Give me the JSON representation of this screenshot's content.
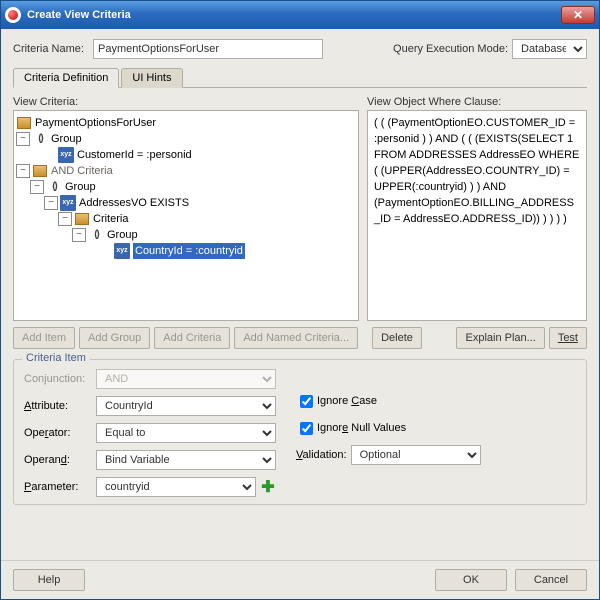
{
  "window": {
    "title": "Create View Criteria"
  },
  "header": {
    "criteria_name_label": "Criteria Name:",
    "criteria_name_value": "PaymentOptionsForUser",
    "qem_label": "Query Execution Mode:",
    "qem_value": "Database"
  },
  "tabs": {
    "definition": "Criteria Definition",
    "uihints": "UI Hints"
  },
  "labels": {
    "view_criteria": "View Criteria:",
    "where_clause": "View Object Where Clause:"
  },
  "tree": {
    "root": "PaymentOptionsForUser",
    "group1": "Group",
    "cust": "CustomerId = :personid",
    "and_criteria": "AND Criteria",
    "group2": "Group",
    "addrvo": "AddressesVO EXISTS",
    "criteria": "Criteria",
    "group3": "Group",
    "selected": "CountryId = :countryid"
  },
  "where_clause": "( ( (PaymentOptionEO.CUSTOMER_ID = :personid ) )  AND ( ( (EXISTS(SELECT 1 FROM ADDRESSES AddressEO WHERE ( (UPPER(AddressEO.COUNTRY_ID) = UPPER(:countryid) ) )  AND (PaymentOptionEO.BILLING_ADDRESS_ID = AddressEO.ADDRESS_ID)) ) ) ) )",
  "buttons": {
    "add_item": "Add Item",
    "add_group": "Add Group",
    "add_criteria": "Add Criteria",
    "add_named": "Add Named Criteria...",
    "delete": "Delete",
    "explain": "Explain Plan...",
    "test": "Test"
  },
  "criteria_item": {
    "legend": "Criteria Item",
    "conjunction_label": "Conjunction:",
    "conjunction_value": "AND",
    "attribute_label": "Attribute:",
    "attribute_value": "CountryId",
    "operator_label": "Operator:",
    "operator_value": "Equal to",
    "operand_label": "Operand:",
    "operand_value": "Bind Variable",
    "parameter_label": "Parameter:",
    "parameter_value": "countryid",
    "ignore_case": "Ignore Case",
    "ignore_nulls": "Ignore Null Values",
    "validation_label": "Validation:",
    "validation_value": "Optional"
  },
  "footer": {
    "help": "Help",
    "ok": "OK",
    "cancel": "Cancel"
  }
}
